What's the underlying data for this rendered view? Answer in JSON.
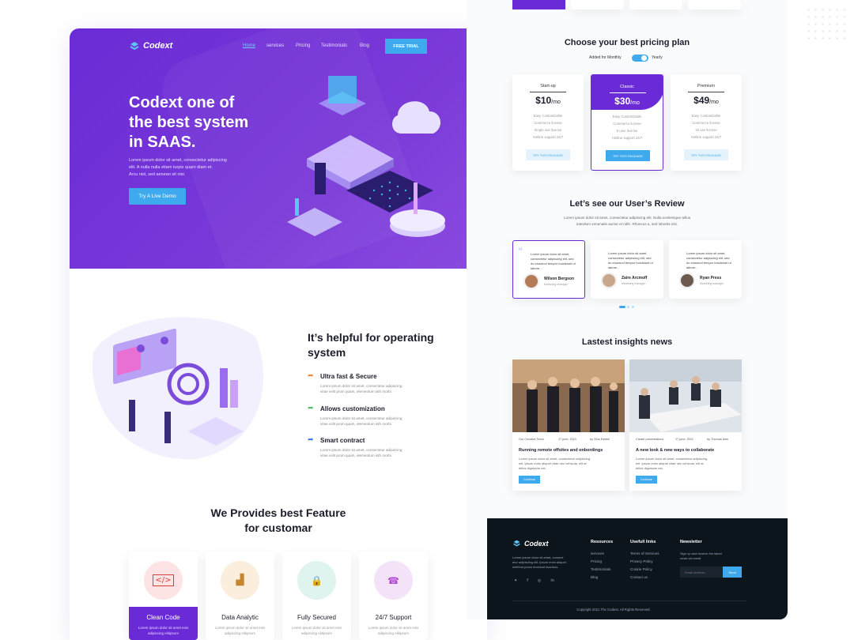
{
  "brand": {
    "name": "Codext",
    "accent": "#3fa9ee",
    "hero_purple": "#6a2bd6"
  },
  "nav": {
    "items": [
      "Home",
      "services",
      "Pricing",
      "Testimonials",
      "Blog"
    ],
    "cta": "FREE TRIAL"
  },
  "hero": {
    "title_1": "Codext one of",
    "title_2": "the best system",
    "title_3": "in SAAS.",
    "text_1": "Lorem ipsum dolor sit amet, consectetur adipiscing",
    "text_2": "elit. A nulla nulla etiam turpis quam diam et.",
    "text_3": "Arcu nisl, sed aenean sit nisi.",
    "button": "Try A Live Demo"
  },
  "helpful": {
    "title_1": "It’s helpful for operating",
    "title_2": "system",
    "items": [
      {
        "title": "Ultra fast & Secure",
        "text_1": "Lorem ipsum dolor sit amet, consectetur adipiscing",
        "text_2": "vitae velit proin quam, elementum sith morbi",
        "color": "#f08a3c"
      },
      {
        "title": "Allows customization",
        "text_1": "Lorem ipsum dolor sit amet, consectetur adipiscing",
        "text_2": "vitae velit proin quam, elementum sith morbi",
        "color": "#4cc06a"
      },
      {
        "title": "Smart contract",
        "text_1": "Lorem ipsum dolor sit amet, consectetur adipiscing",
        "text_2": "vitae velit proin quam, elementum sith morbi",
        "color": "#3f7fe8"
      }
    ]
  },
  "features": {
    "title_1": "We Provides best Feature",
    "title_2": "for customar",
    "cards": [
      {
        "name": "Clean Code",
        "icon": "code-icon",
        "text_1": "Lorem ipsum dolor sit amet enis",
        "text_2": "adipiscing elitipsum",
        "circle": "#fde3e3",
        "glyph": "</>"
      },
      {
        "name": "Data Analytic",
        "icon": "bar-chart-icon",
        "text_1": "Lorem ipsum dolor sit amet enis",
        "text_2": "adipiscing elitipsum",
        "circle": "#fbeedd",
        "glyph": "▟"
      },
      {
        "name": "Fully Secured",
        "icon": "folder-lock-icon",
        "text_1": "Lorem ipsum dolor sit amet enis",
        "text_2": "adipiscing elitipsum",
        "circle": "#dff4ef",
        "glyph": "🔒"
      },
      {
        "name": "24/7 Support",
        "icon": "support-icon",
        "text_1": "Lorem ipsum dolor sit amet enis",
        "text_2": "adipiscing elitipsum",
        "circle": "#f4e3f8",
        "glyph": "☎"
      }
    ]
  },
  "pricing": {
    "title": "Choose your best pricing plan",
    "toggle_left": "Added for Monthly",
    "toggle_right": "Yearly",
    "plans": [
      {
        "name": "Start-up",
        "price": "$10",
        "per": "/mo",
        "button": "TRY THIS PACKAGE",
        "features": [
          "Easy Customizable",
          "Commerce license",
          "Single use license",
          "Hotline support 24/7"
        ]
      },
      {
        "name": "Classic",
        "price": "$30",
        "per": "/mo",
        "button": "TRY THIS PACKAGE",
        "features": [
          "Easy Customizable",
          "Commerce license",
          "5 user license",
          "Hotline support 24/7"
        ]
      },
      {
        "name": "Premium",
        "price": "$49",
        "per": "/mo",
        "button": "TRY THIS PACKAGE",
        "features": [
          "Easy Customizable",
          "Commerce license",
          "15 use license",
          "Hotline support 24/7"
        ]
      }
    ]
  },
  "reviews": {
    "title": "Let’s see our User’s Review",
    "sub_1": "Lorem ipsum dolor sit amet, consectetur adipiscing elit. Nulla scelerisque tellus",
    "sub_2": "interdum venenatis auctor et nibh. Rhoncus a, sed lobortis nisi.",
    "items": [
      {
        "name": "Wilson Bergson",
        "role": "Marketing manager"
      },
      {
        "name": "Zaire Arcmoff",
        "role": "Marketing manager"
      },
      {
        "name": "Ryan Press",
        "role": "Marketing manager"
      }
    ],
    "quote_1": "Lorem ipsum dolor sit amet,",
    "quote_2": "consectetur adipiscing elit, sed",
    "quote_3": "do eiusmod tempor incididunt ut",
    "quote_4": "labore..."
  },
  "news": {
    "title": "Lastest insights news",
    "items": [
      {
        "tag": "Our Creative Team",
        "date": "17 june, 2021",
        "author": "by Sina Estelle",
        "headline": "Running remote offsites and onbordings",
        "button": "Continue"
      },
      {
        "tag": "Create presentations",
        "date": "17 june, 2021",
        "author": "by Thomas lane",
        "headline": "A new look & new ways to collaborate",
        "button": "Continue"
      }
    ],
    "excerpt_1": "Lorem ipsum dolor sit amet, consectetur adipiscing",
    "excerpt_2": "elit. Ipsum enim aliquet vitae nec vehicula, elit at",
    "excerpt_3": "tellus dignissim est."
  },
  "footer": {
    "about_1": "Lorem ipsum dolor sit amet, consect",
    "about_2": "etur adipiscing elit. Ipsum enim aliquet",
    "about_3": "eleifend purus tincidunt faucibus.",
    "resources_title": "Resources",
    "resources": [
      "services",
      "Pricing",
      "Testimonials",
      "Blog"
    ],
    "useful_title": "Usefull links",
    "useful": [
      "Terms of Services",
      "Privacy Policy",
      "Cookie Policy",
      "Contact us"
    ],
    "newsletter_title": "Newsletter",
    "newsletter_text_1": "Sign up and receive the latest",
    "newsletter_text_2": "news via email",
    "email_placeholder": "Email address",
    "send": "Send",
    "copyright": "Copyright 2021 The Codext. All Rights Reserved."
  }
}
